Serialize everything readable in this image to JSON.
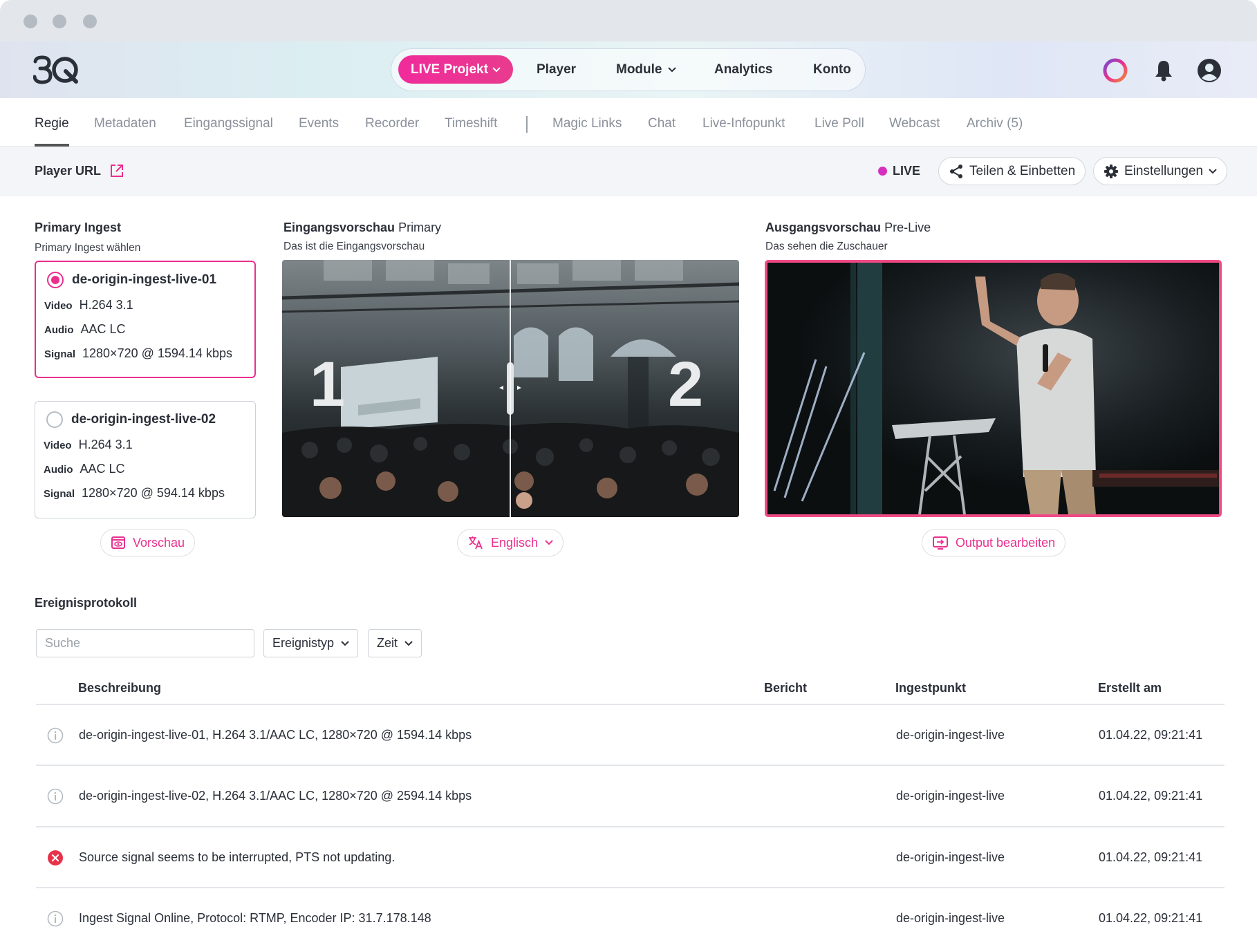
{
  "topnav": {
    "live_project": "LIVE Projekt",
    "player": "Player",
    "module": "Module",
    "analytics": "Analytics",
    "konto": "Konto"
  },
  "tabs": [
    {
      "label": "Regie",
      "active": true
    },
    {
      "label": "Metadaten"
    },
    {
      "label": "Eingangssignal"
    },
    {
      "label": "Events"
    },
    {
      "label": "Recorder"
    },
    {
      "label": "Timeshift"
    },
    {
      "label": "Magic Links"
    },
    {
      "label": "Chat"
    },
    {
      "label": "Live-Infopunkt"
    },
    {
      "label": "Live Poll"
    },
    {
      "label": "Webcast"
    },
    {
      "label": "Archiv (5)"
    }
  ],
  "subbar": {
    "player_url": "Player URL",
    "live": "LIVE",
    "share": "Teilen & Einbetten",
    "settings": "Einstellungen"
  },
  "ingest": {
    "heading": "Primary Ingest",
    "sub": "Primary Ingest wählen",
    "cards": [
      {
        "name": "de-origin-ingest-live-01",
        "selected": true,
        "video_label": "Video",
        "video": "H.264 3.1",
        "audio_label": "Audio",
        "audio": "AAC LC",
        "signal_label": "Signal",
        "signal": "1280×720 @ 1594.14 kbps"
      },
      {
        "name": "de-origin-ingest-live-02",
        "selected": false,
        "video_label": "Video",
        "video": "H.264 3.1",
        "audio_label": "Audio",
        "audio": "AAC LC",
        "signal_label": "Signal",
        "signal": "1280×720 @ 594.14 kbps"
      }
    ],
    "preview_button": "Vorschau"
  },
  "input_preview": {
    "heading_bold": "Eingangsvorschau",
    "heading_light": "Primary",
    "sub": "Das ist die Eingangsvorschau",
    "left_label": "1",
    "right_label": "2",
    "language_button": "Englisch"
  },
  "output_preview": {
    "heading_bold": "Ausgangsvorschau",
    "heading_light": "Pre-Live",
    "sub": "Das sehen die Zuschauer",
    "edit_button": "Output bearbeiten"
  },
  "log": {
    "heading": "Ereignisprotokoll",
    "search_placeholder": "Suche",
    "filter_type": "Ereignistyp",
    "filter_time": "Zeit",
    "columns": [
      "Beschreibung",
      "Bericht",
      "Ingestpunkt",
      "Erstellt am"
    ],
    "rows": [
      {
        "icon": "info-icon",
        "description": "de-origin-ingest-live-01, H.264 3.1/AAC LC, 1280×720 @ 1594.14 kbps",
        "report": "",
        "ingest": "de-origin-ingest-live",
        "created": "01.04.22, 09:21:41"
      },
      {
        "icon": "info-icon",
        "description": "de-origin-ingest-live-02, H.264 3.1/AAC LC, 1280×720 @ 2594.14 kbps",
        "report": "",
        "ingest": "de-origin-ingest-live",
        "created": "01.04.22, 09:21:41"
      },
      {
        "icon": "error-icon",
        "description": "Source signal seems to be interrupted, PTS not updating.",
        "report": "",
        "ingest": "de-origin-ingest-live",
        "created": "01.04.22, 09:21:41"
      },
      {
        "icon": "info-icon",
        "description": "Ingest Signal Online, Protocol: RTMP, Encoder IP: 31.7.178.148",
        "report": "",
        "ingest": "de-origin-ingest-live",
        "created": "01.04.22, 09:21:41"
      }
    ]
  },
  "colors": {
    "accent": "#ea2f8e",
    "live_dot": "#d62fc0",
    "error": "#e8324a"
  }
}
